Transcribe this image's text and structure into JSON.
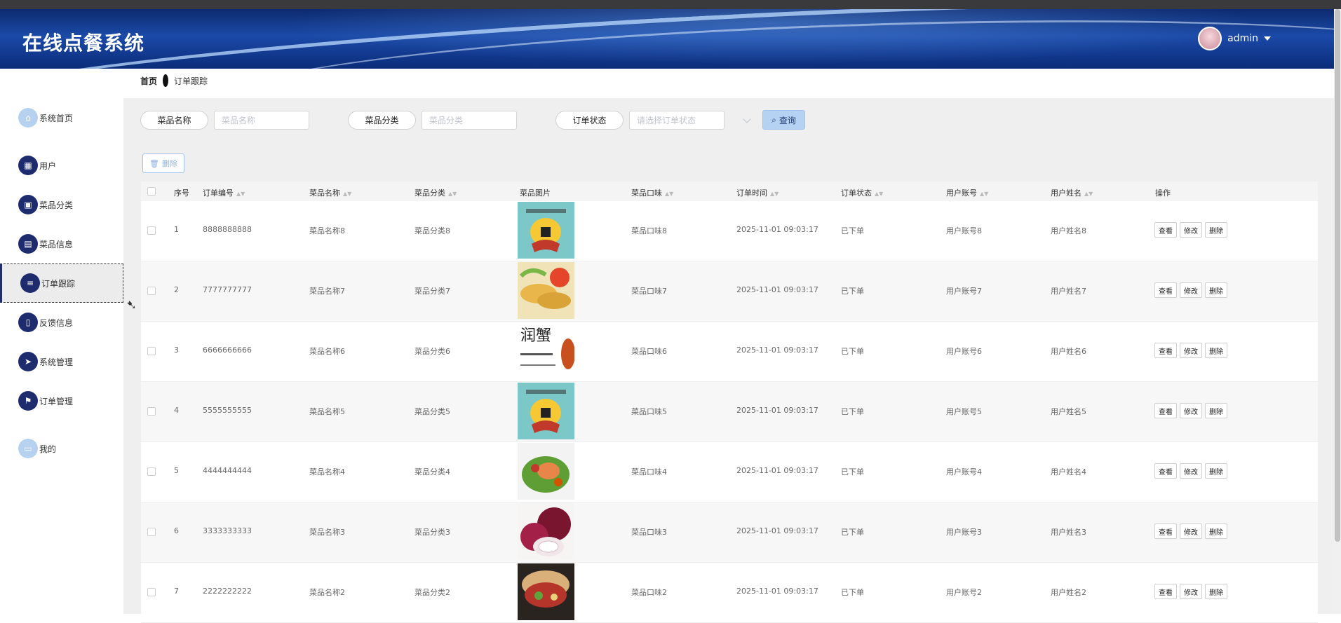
{
  "header": {
    "title": "在线点餐系统",
    "username": "admin"
  },
  "breadcrumb": {
    "home": "首页",
    "current": "订单跟踪"
  },
  "sidebar": {
    "items": [
      {
        "label": "系统首页",
        "icon": "home-icon"
      },
      {
        "label": "用户",
        "icon": "grid-icon"
      },
      {
        "label": "菜品分类",
        "icon": "briefcase-icon"
      },
      {
        "label": "菜品信息",
        "icon": "clipboard-icon"
      },
      {
        "label": "订单跟踪",
        "icon": "sliders-icon"
      },
      {
        "label": "反馈信息",
        "icon": "document-icon"
      },
      {
        "label": "系统管理",
        "icon": "send-icon"
      },
      {
        "label": "订单管理",
        "icon": "flag-icon"
      },
      {
        "label": "我的",
        "icon": "card-icon"
      }
    ]
  },
  "search": {
    "dish_name_label": "菜品名称",
    "dish_name_placeholder": "菜品名称",
    "category_label": "菜品分类",
    "category_placeholder": "菜品分类",
    "status_label": "订单状态",
    "status_placeholder": "请选择订单状态",
    "query_label": "查询"
  },
  "toolbar": {
    "delete_label": "删除"
  },
  "table": {
    "columns": [
      "序号",
      "订单编号",
      "菜品名称",
      "菜品分类",
      "菜品图片",
      "菜品口味",
      "订单时间",
      "订单状态",
      "用户账号",
      "用户姓名",
      "操作"
    ],
    "actions": [
      "查看",
      "修改",
      "删除"
    ],
    "rows": [
      {
        "no": "1",
        "order": "8888888888",
        "name": "菜品名称8",
        "cat": "菜品分类8",
        "taste": "菜品口味8",
        "time": "2025-11-01 09:03:17",
        "status": "已下单",
        "account": "用户账号8",
        "user": "用户姓名8",
        "img": "mascot"
      },
      {
        "no": "2",
        "order": "7777777777",
        "name": "菜品名称7",
        "cat": "菜品分类7",
        "taste": "菜品口味7",
        "time": "2025-11-01 09:03:17",
        "status": "已下单",
        "account": "用户账号7",
        "user": "用户姓名7",
        "img": "dumplings"
      },
      {
        "no": "3",
        "order": "6666666666",
        "name": "菜品名称6",
        "cat": "菜品分类6",
        "taste": "菜品口味6",
        "time": "2025-11-01 09:03:17",
        "status": "已下单",
        "account": "用户账号6",
        "user": "用户姓名6",
        "img": "calligraphy"
      },
      {
        "no": "4",
        "order": "5555555555",
        "name": "菜品名称5",
        "cat": "菜品分类5",
        "taste": "菜品口味5",
        "time": "2025-11-01 09:03:17",
        "status": "已下单",
        "account": "用户账号5",
        "user": "用户姓名5",
        "img": "mascot"
      },
      {
        "no": "5",
        "order": "4444444444",
        "name": "菜品名称4",
        "cat": "菜品分类4",
        "taste": "菜品口味4",
        "time": "2025-11-01 09:03:17",
        "status": "已下单",
        "account": "用户账号4",
        "user": "用户姓名4",
        "img": "salad"
      },
      {
        "no": "6",
        "order": "3333333333",
        "name": "菜品名称3",
        "cat": "菜品分类3",
        "taste": "菜品口味3",
        "time": "2025-11-01 09:03:17",
        "status": "已下单",
        "account": "用户账号3",
        "user": "用户姓名3",
        "img": "onion"
      },
      {
        "no": "7",
        "order": "2222222222",
        "name": "菜品名称2",
        "cat": "菜品分类2",
        "taste": "菜品口味2",
        "time": "2025-11-01 09:03:17",
        "status": "已下单",
        "account": "用户账号2",
        "user": "用户姓名2",
        "img": "wrap"
      }
    ]
  }
}
